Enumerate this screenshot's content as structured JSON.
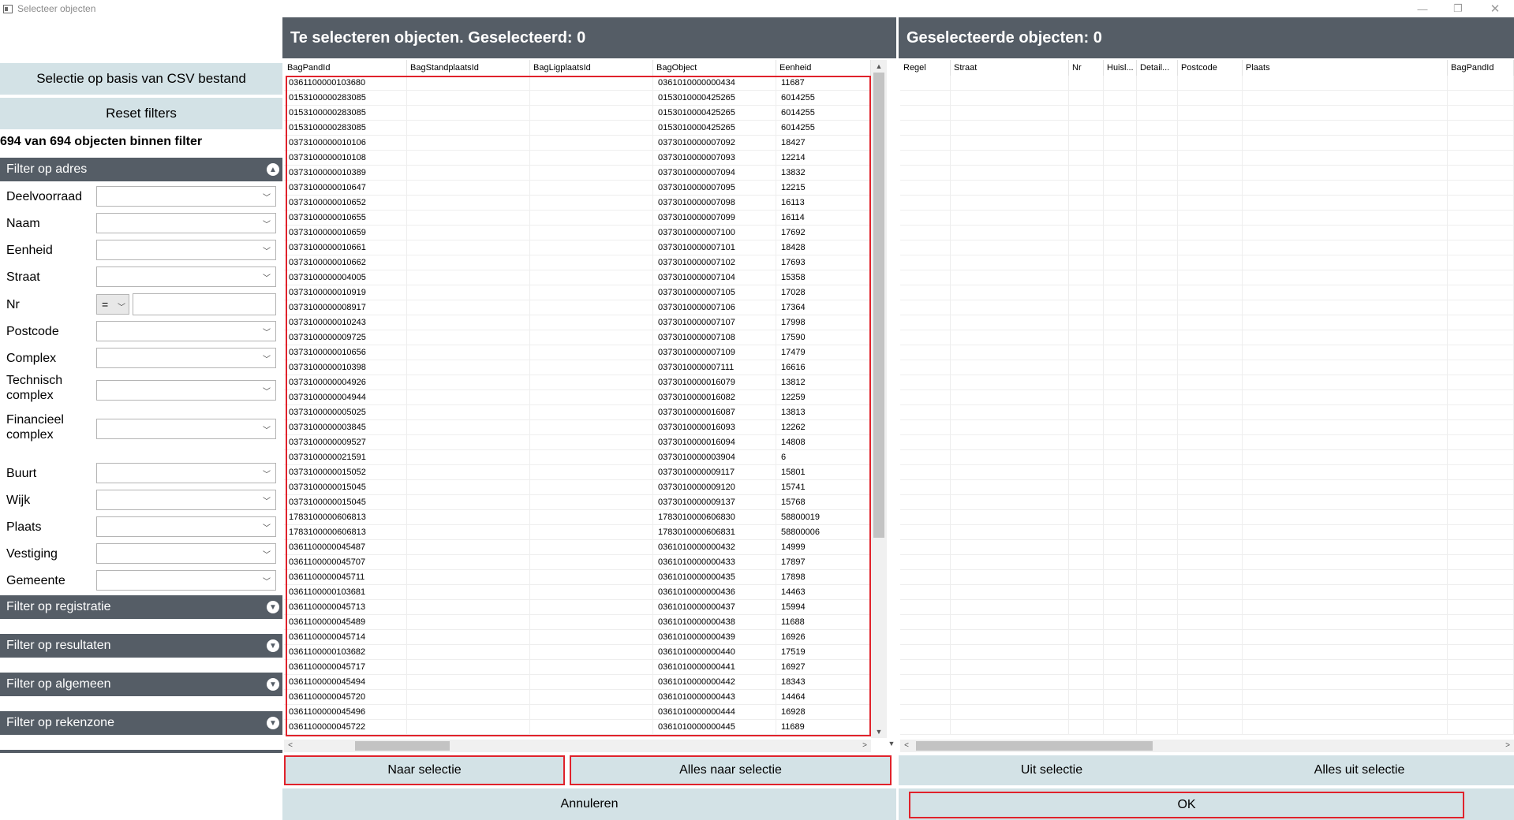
{
  "window": {
    "title": "Selecteer objecten",
    "minimize_glyph": "—",
    "restore_glyph": "❐",
    "close_glyph": "✕"
  },
  "left": {
    "csv_button": "Selectie op basis van CSV bestand",
    "reset_button": "Reset filters",
    "count_text": "694 van 694 objecten binnen filter",
    "filter_adres": "Filter op adres",
    "fields": {
      "deelvoorraad": "Deelvoorraad",
      "naam": "Naam",
      "eenheid": "Eenheid",
      "straat": "Straat",
      "nr": "Nr",
      "nr_operator": "=",
      "postcode": "Postcode",
      "complex": "Complex",
      "technisch": "Technisch complex",
      "financieel": "Financieel complex",
      "buurt": "Buurt",
      "wijk": "Wijk",
      "plaats": "Plaats",
      "vestiging": "Vestiging",
      "gemeente": "Gemeente"
    },
    "filter_registratie": "Filter op registratie",
    "filter_resultaten": "Filter op resultaten",
    "filter_algemeen": "Filter op algemeen",
    "filter_rekenzone": "Filter op rekenzone"
  },
  "middle": {
    "header": "Te selecteren objecten. Geselecteerd: 0",
    "columns": [
      "BagPandId",
      "BagStandplaatsId",
      "BagLigplaatsId",
      "BagObject",
      "Eenheid"
    ],
    "rows": [
      [
        "0361100000103680",
        "",
        "",
        "0361010000000434",
        "11687"
      ],
      [
        "0153100000283085",
        "",
        "",
        "0153010000425265",
        "6014255"
      ],
      [
        "0153100000283085",
        "",
        "",
        "0153010000425265",
        "6014255"
      ],
      [
        "0153100000283085",
        "",
        "",
        "0153010000425265",
        "6014255"
      ],
      [
        "0373100000010106",
        "",
        "",
        "0373010000007092",
        "18427"
      ],
      [
        "0373100000010108",
        "",
        "",
        "0373010000007093",
        "12214"
      ],
      [
        "0373100000010389",
        "",
        "",
        "0373010000007094",
        "13832"
      ],
      [
        "0373100000010647",
        "",
        "",
        "0373010000007095",
        "12215"
      ],
      [
        "0373100000010652",
        "",
        "",
        "0373010000007098",
        "16113"
      ],
      [
        "0373100000010655",
        "",
        "",
        "0373010000007099",
        "16114"
      ],
      [
        "0373100000010659",
        "",
        "",
        "0373010000007100",
        "17692"
      ],
      [
        "0373100000010661",
        "",
        "",
        "0373010000007101",
        "18428"
      ],
      [
        "0373100000010662",
        "",
        "",
        "0373010000007102",
        "17693"
      ],
      [
        "0373100000004005",
        "",
        "",
        "0373010000007104",
        "15358"
      ],
      [
        "0373100000010919",
        "",
        "",
        "0373010000007105",
        "17028"
      ],
      [
        "0373100000008917",
        "",
        "",
        "0373010000007106",
        "17364"
      ],
      [
        "0373100000010243",
        "",
        "",
        "0373010000007107",
        "17998"
      ],
      [
        "0373100000009725",
        "",
        "",
        "0373010000007108",
        "17590"
      ],
      [
        "0373100000010656",
        "",
        "",
        "0373010000007109",
        "17479"
      ],
      [
        "0373100000010398",
        "",
        "",
        "0373010000007111",
        "16616"
      ],
      [
        "0373100000004926",
        "",
        "",
        "0373010000016079",
        "13812"
      ],
      [
        "0373100000004944",
        "",
        "",
        "0373010000016082",
        "12259"
      ],
      [
        "0373100000005025",
        "",
        "",
        "0373010000016087",
        "13813"
      ],
      [
        "0373100000003845",
        "",
        "",
        "0373010000016093",
        "12262"
      ],
      [
        "0373100000009527",
        "",
        "",
        "0373010000016094",
        "14808"
      ],
      [
        "0373100000021591",
        "",
        "",
        "0373010000003904",
        "6"
      ],
      [
        "0373100000015052",
        "",
        "",
        "0373010000009117",
        "15801"
      ],
      [
        "0373100000015045",
        "",
        "",
        "0373010000009120",
        "15741"
      ],
      [
        "0373100000015045",
        "",
        "",
        "0373010000009137",
        "15768"
      ],
      [
        "1783100000606813",
        "",
        "",
        "1783010000606830",
        "58800019"
      ],
      [
        "1783100000606813",
        "",
        "",
        "1783010000606831",
        "58800006"
      ],
      [
        "0361100000045487",
        "",
        "",
        "0361010000000432",
        "14999"
      ],
      [
        "0361100000045707",
        "",
        "",
        "0361010000000433",
        "17897"
      ],
      [
        "0361100000045711",
        "",
        "",
        "0361010000000435",
        "17898"
      ],
      [
        "0361100000103681",
        "",
        "",
        "0361010000000436",
        "14463"
      ],
      [
        "0361100000045713",
        "",
        "",
        "0361010000000437",
        "15994"
      ],
      [
        "0361100000045489",
        "",
        "",
        "0361010000000438",
        "11688"
      ],
      [
        "0361100000045714",
        "",
        "",
        "0361010000000439",
        "16926"
      ],
      [
        "0361100000103682",
        "",
        "",
        "0361010000000440",
        "17519"
      ],
      [
        "0361100000045717",
        "",
        "",
        "0361010000000441",
        "16927"
      ],
      [
        "0361100000045494",
        "",
        "",
        "0361010000000442",
        "18343"
      ],
      [
        "0361100000045720",
        "",
        "",
        "0361010000000443",
        "14464"
      ],
      [
        "0361100000045496",
        "",
        "",
        "0361010000000444",
        "16928"
      ],
      [
        "0361100000045722",
        "",
        "",
        "0361010000000445",
        "11689"
      ]
    ],
    "btn_naar": "Naar selectie",
    "btn_alles_naar": "Alles naar selectie"
  },
  "right": {
    "header": "Geselecteerde objecten: 0",
    "columns": [
      "Regel",
      "Straat",
      "Nr",
      "Huisl...",
      "Detail...",
      "Postcode",
      "Plaats",
      "BagPandId"
    ],
    "btn_uit": "Uit selectie",
    "btn_alles_uit": "Alles uit selectie"
  },
  "footer": {
    "annuleren": "Annuleren",
    "ok": "OK"
  },
  "scroll": {
    "up": "▲",
    "down": "▼",
    "left": "<",
    "right": ">"
  },
  "colors": {
    "header_bg": "#555d66",
    "button_bg": "#d3e2e6",
    "highlight": "#e0222b"
  }
}
